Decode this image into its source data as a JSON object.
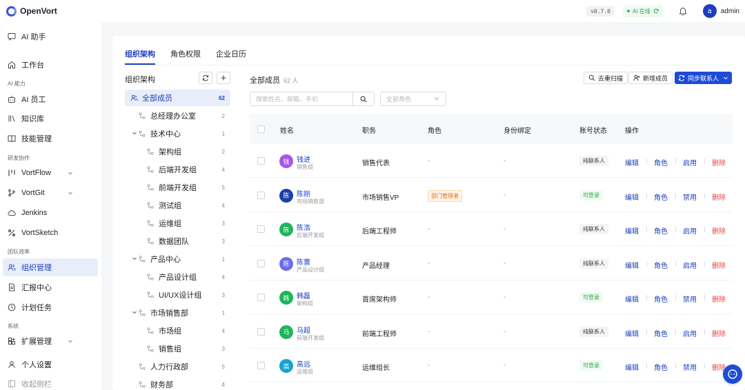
{
  "app": {
    "name": "OpenVort",
    "version": "v0.7.0",
    "ai_status": "AI 在线",
    "user_initial": "a",
    "user_name": "admin"
  },
  "sidebar": {
    "items": [
      {
        "label": "AI 助手",
        "icon": "chat-icon"
      },
      {
        "label": "工作台",
        "icon": "home-icon"
      },
      {
        "label": "AI 员工",
        "icon": "robot-icon"
      },
      {
        "label": "知识库",
        "icon": "library-icon"
      },
      {
        "label": "技能管理",
        "icon": "book-icon"
      },
      {
        "label": "VortFlow",
        "icon": "flow-icon"
      },
      {
        "label": "VortGit",
        "icon": "git-icon"
      },
      {
        "label": "Jenkins",
        "icon": "cloud-icon"
      },
      {
        "label": "VortSketch",
        "icon": "sketch-icon"
      },
      {
        "label": "组织管理",
        "icon": "users-icon"
      },
      {
        "label": "汇报中心",
        "icon": "report-icon"
      },
      {
        "label": "计划任务",
        "icon": "clock-icon"
      },
      {
        "label": "扩展管理",
        "icon": "extension-icon"
      },
      {
        "label": "个人设置",
        "icon": "user-icon"
      },
      {
        "label": "收起侧栏",
        "icon": "collapse-icon"
      }
    ],
    "sections": [
      "AI 能力",
      "研发协作",
      "团队效率",
      "系统"
    ]
  },
  "tabs": [
    "组织架构",
    "角色权限",
    "企业日历"
  ],
  "tree": {
    "title": "组织架构",
    "nodes": [
      {
        "label": "全部成员",
        "count": "62"
      },
      {
        "label": "总经理办公室",
        "count": "2"
      },
      {
        "label": "技术中心",
        "count": "1"
      },
      {
        "label": "架构组",
        "count": "2"
      },
      {
        "label": "后端开发组",
        "count": "4"
      },
      {
        "label": "前端开发组",
        "count": "5"
      },
      {
        "label": "测试组",
        "count": "4"
      },
      {
        "label": "运维组",
        "count": "3"
      },
      {
        "label": "数据团队",
        "count": "3"
      },
      {
        "label": "产品中心",
        "count": "1"
      },
      {
        "label": "产品设计组",
        "count": "4"
      },
      {
        "label": "UI/UX设计组",
        "count": "3"
      },
      {
        "label": "市场销售部",
        "count": "1"
      },
      {
        "label": "市场组",
        "count": "4"
      },
      {
        "label": "销售组",
        "count": "3"
      },
      {
        "label": "人力行政部",
        "count": "5"
      },
      {
        "label": "财务部",
        "count": "4"
      }
    ]
  },
  "panel": {
    "title": "全部成员",
    "count": "62 人",
    "dedupe": "去重扫描",
    "add": "新增成员",
    "sync": "同步联系人",
    "search_placeholder": "搜索姓名、邮箱、手机",
    "role_placeholder": "全部角色"
  },
  "table": {
    "headers": {
      "name": "姓名",
      "title": "职务",
      "role": "角色",
      "bind": "身份绑定",
      "status": "账号状态",
      "ops": "操作"
    },
    "op_labels": {
      "edit": "编辑",
      "role": "角色",
      "enable": "启用",
      "disable": "禁用",
      "delete": "删除"
    },
    "rows": [
      {
        "initial": "钱",
        "name": "钱进",
        "dept": "销售组",
        "title": "销售代表",
        "role": "-",
        "bind": "-",
        "status": "纯联系人",
        "toggle": "启用",
        "color": "#a857e8"
      },
      {
        "initial": "陈",
        "name": "陈刚",
        "dept": "市场销售部",
        "title": "市场销售VP",
        "role": "部门管理者",
        "bind": "-",
        "status": "可登录",
        "toggle": "禁用",
        "color": "#1d3fa8"
      },
      {
        "initial": "陈",
        "name": "陈浩",
        "dept": "后端开发组",
        "title": "后端工程师",
        "role": "-",
        "bind": "-",
        "status": "纯联系人",
        "toggle": "启用",
        "color": "#1fb45b"
      },
      {
        "initial": "陈",
        "name": "陈蕾",
        "dept": "产品设计组",
        "title": "产品经理",
        "role": "-",
        "bind": "-",
        "status": "纯联系人",
        "toggle": "启用",
        "color": "#6b6fe6"
      },
      {
        "initial": "韩",
        "name": "韩磊",
        "dept": "架构组",
        "title": "首席架构师",
        "role": "-",
        "bind": "-",
        "status": "可登录",
        "toggle": "禁用",
        "color": "#1fb45b"
      },
      {
        "initial": "马",
        "name": "马超",
        "dept": "前端开发组",
        "title": "前端工程师",
        "role": "-",
        "bind": "-",
        "status": "纯联系人",
        "toggle": "启用",
        "color": "#1fb45b"
      },
      {
        "initial": "高",
        "name": "高远",
        "dept": "运维组",
        "title": "运维组长",
        "role": "-",
        "bind": "-",
        "status": "可登录",
        "toggle": "禁用",
        "color": "#14a3cf"
      }
    ]
  }
}
